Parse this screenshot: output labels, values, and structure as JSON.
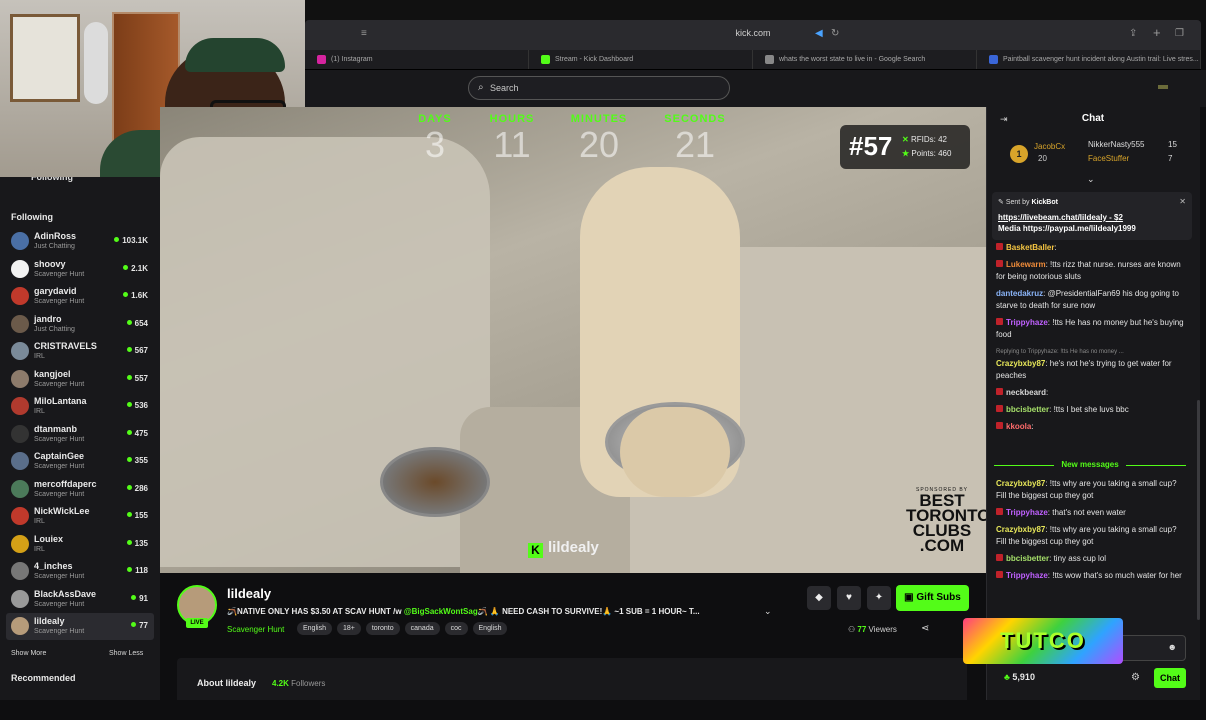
{
  "browser": {
    "url": "kick.com",
    "tabs": [
      {
        "label": "(1) Instagram",
        "color": "#d6249f"
      },
      {
        "label": "Stream - Kick Dashboard",
        "color": "#53fc18"
      },
      {
        "label": "whats the worst state to live in - Google Search",
        "color": "#888888"
      },
      {
        "label": "Paintball scavenger hunt incident along Austin trail: Live stres...",
        "color": "#3a66d8"
      }
    ]
  },
  "header": {
    "search_placeholder": "Search"
  },
  "sidebar": {
    "following_top": "Following",
    "following_heading": "Following",
    "items": [
      {
        "name": "AdinRoss",
        "category": "Just Chatting",
        "viewers": "103.1K",
        "color": "#4a6fa5"
      },
      {
        "name": "shoovy",
        "category": "Scavenger Hunt",
        "viewers": "2.1K",
        "color": "#f2f2f2"
      },
      {
        "name": "garydavid",
        "category": "Scavenger Hunt",
        "viewers": "1.6K",
        "color": "#c0392b"
      },
      {
        "name": "jandro",
        "category": "Just Chatting",
        "viewers": "654",
        "color": "#6b5a4a"
      },
      {
        "name": "CRISTRAVELS",
        "category": "IRL",
        "viewers": "567",
        "color": "#7a8a99"
      },
      {
        "name": "kangjoel",
        "category": "Scavenger Hunt",
        "viewers": "557",
        "color": "#8d7b6b"
      },
      {
        "name": "MiloLantana",
        "category": "IRL",
        "viewers": "536",
        "color": "#b03a2e"
      },
      {
        "name": "dtanmanb",
        "category": "Scavenger Hunt",
        "viewers": "475",
        "color": "#333333"
      },
      {
        "name": "CaptainGee",
        "category": "Scavenger Hunt",
        "viewers": "355",
        "color": "#5a6e8a"
      },
      {
        "name": "mercoffdaperc",
        "category": "Scavenger Hunt",
        "viewers": "286",
        "color": "#4b7a5a"
      },
      {
        "name": "NickWickLee",
        "category": "IRL",
        "viewers": "155",
        "color": "#c0392b"
      },
      {
        "name": "Louiex",
        "category": "IRL",
        "viewers": "135",
        "color": "#d4a017"
      },
      {
        "name": "4_inches",
        "category": "Scavenger Hunt",
        "viewers": "118",
        "color": "#777777"
      },
      {
        "name": "BlackAssDave",
        "category": "Scavenger Hunt",
        "viewers": "91",
        "color": "#999999"
      },
      {
        "name": "lildealy",
        "category": "Scavenger Hunt",
        "viewers": "77",
        "color": "#b69b7a"
      }
    ],
    "show_more": "Show More",
    "show_less": "Show Less",
    "recommended_heading": "Recommended"
  },
  "video": {
    "timer": [
      {
        "label": "DAYS",
        "value": "3"
      },
      {
        "label": "HOURS",
        "value": "11"
      },
      {
        "label": "MINUTES",
        "value": "20"
      },
      {
        "label": "SECONDS",
        "value": "21"
      }
    ],
    "counter_num": "#57",
    "rfids_label": "RFIDs:",
    "rfids_value": "42",
    "points_label": "Points:",
    "points_value": "460",
    "watermark": "lildealy",
    "sponsor_small": "SPONSORED BY",
    "sponsor_big": "BEST TORONTO CLUBS .COM"
  },
  "channel": {
    "name": "lildealy",
    "live": "LIVE",
    "title_pre": "🪃NATIVE ONLY HAS $3.50 AT SCAV HUNT  /w ",
    "title_mention": "@BigSackWontSag",
    "title_post": "🪃 🙏 NEED CASH TO SURVIVE!🙏 ~1 SUB = 1 HOUR~ T...",
    "category": "Scavenger Hunt",
    "tags": [
      "English",
      "18+",
      "toronto",
      "canada",
      "coc",
      "English"
    ],
    "gift_subs": "Gift Subs",
    "viewers_count": "77",
    "viewers_label": "Viewers",
    "about": "About lildealy",
    "followers_count": "4.2K",
    "followers_label": "Followers"
  },
  "chat": {
    "title": "Chat",
    "gifters": [
      {
        "rank": "1",
        "name": "JacobCx",
        "count": "20"
      },
      {
        "name": "NikkerNasty555",
        "count": "15"
      },
      {
        "name": "FaceStuffer",
        "count": "7"
      }
    ],
    "pinned_sent_prefix": "Sent by",
    "pinned_sender": "KickBot",
    "pinned_line1": "https://livebeam.chat/lildealy - $2",
    "pinned_line2": "Media https://paypal.me/lildealy1999",
    "messages": [
      {
        "user": "BasketBaller",
        "color": "#f4c542",
        "text": ":",
        "badge": true
      },
      {
        "user": "Lukewarm",
        "color": "#f08c3a",
        "text": ": !tts rizz that nurse. nurses are known for being notorious sluts",
        "badge": true
      },
      {
        "user": "dantedakruz",
        "color": "#8ab4f8",
        "text": ": @PresidentialFan69 his dog going to starve to death for sure now",
        "badge": false
      },
      {
        "user": "Trippyhaze",
        "color": "#c061ff",
        "text": ": !tts He has no money but he's buying food",
        "badge": true
      },
      {
        "user": "Crazybxby87",
        "color": "#e8e85a",
        "text": ": he's not he's trying to get water for peaches",
        "badge": false,
        "reply": "Replying to Trippyhaze: !tts He has no money ..."
      },
      {
        "user": "neckbeard",
        "color": "#d6d6d6",
        "text": ":",
        "badge": true
      },
      {
        "user": "bbcisbetter",
        "color": "#a6e06a",
        "text": ": !tts I bet she luvs bbc",
        "badge": true
      },
      {
        "user": "kkoola",
        "color": "#ff6b6b",
        "text": ":",
        "badge": true
      }
    ],
    "new_messages": "New messages",
    "messages2": [
      {
        "user": "Crazybxby87",
        "color": "#e8e85a",
        "text": ": !tts why are you taking a small cup? Fill the biggest cup they got",
        "badge": false
      },
      {
        "user": "Trippyhaze",
        "color": "#c061ff",
        "text": ": that's not even water",
        "badge": true
      },
      {
        "user": "Crazybxby87",
        "color": "#e8e85a",
        "text": ": !tts why are you taking a small cup? Fill the biggest cup they got",
        "badge": false
      },
      {
        "user": "bbcisbetter",
        "color": "#a6e06a",
        "text": ": tiny ass cup lol",
        "badge": true
      },
      {
        "user": "Trippyhaze",
        "color": "#c061ff",
        "text": ": !tts wow that's so much water for her",
        "badge": true
      }
    ],
    "points": "5,910",
    "chat_button": "Chat",
    "emote_overlay": "TUTCO"
  },
  "colors": {
    "accent": "#53fc18",
    "bg": "#0e0e10",
    "panel": "#18181b"
  }
}
